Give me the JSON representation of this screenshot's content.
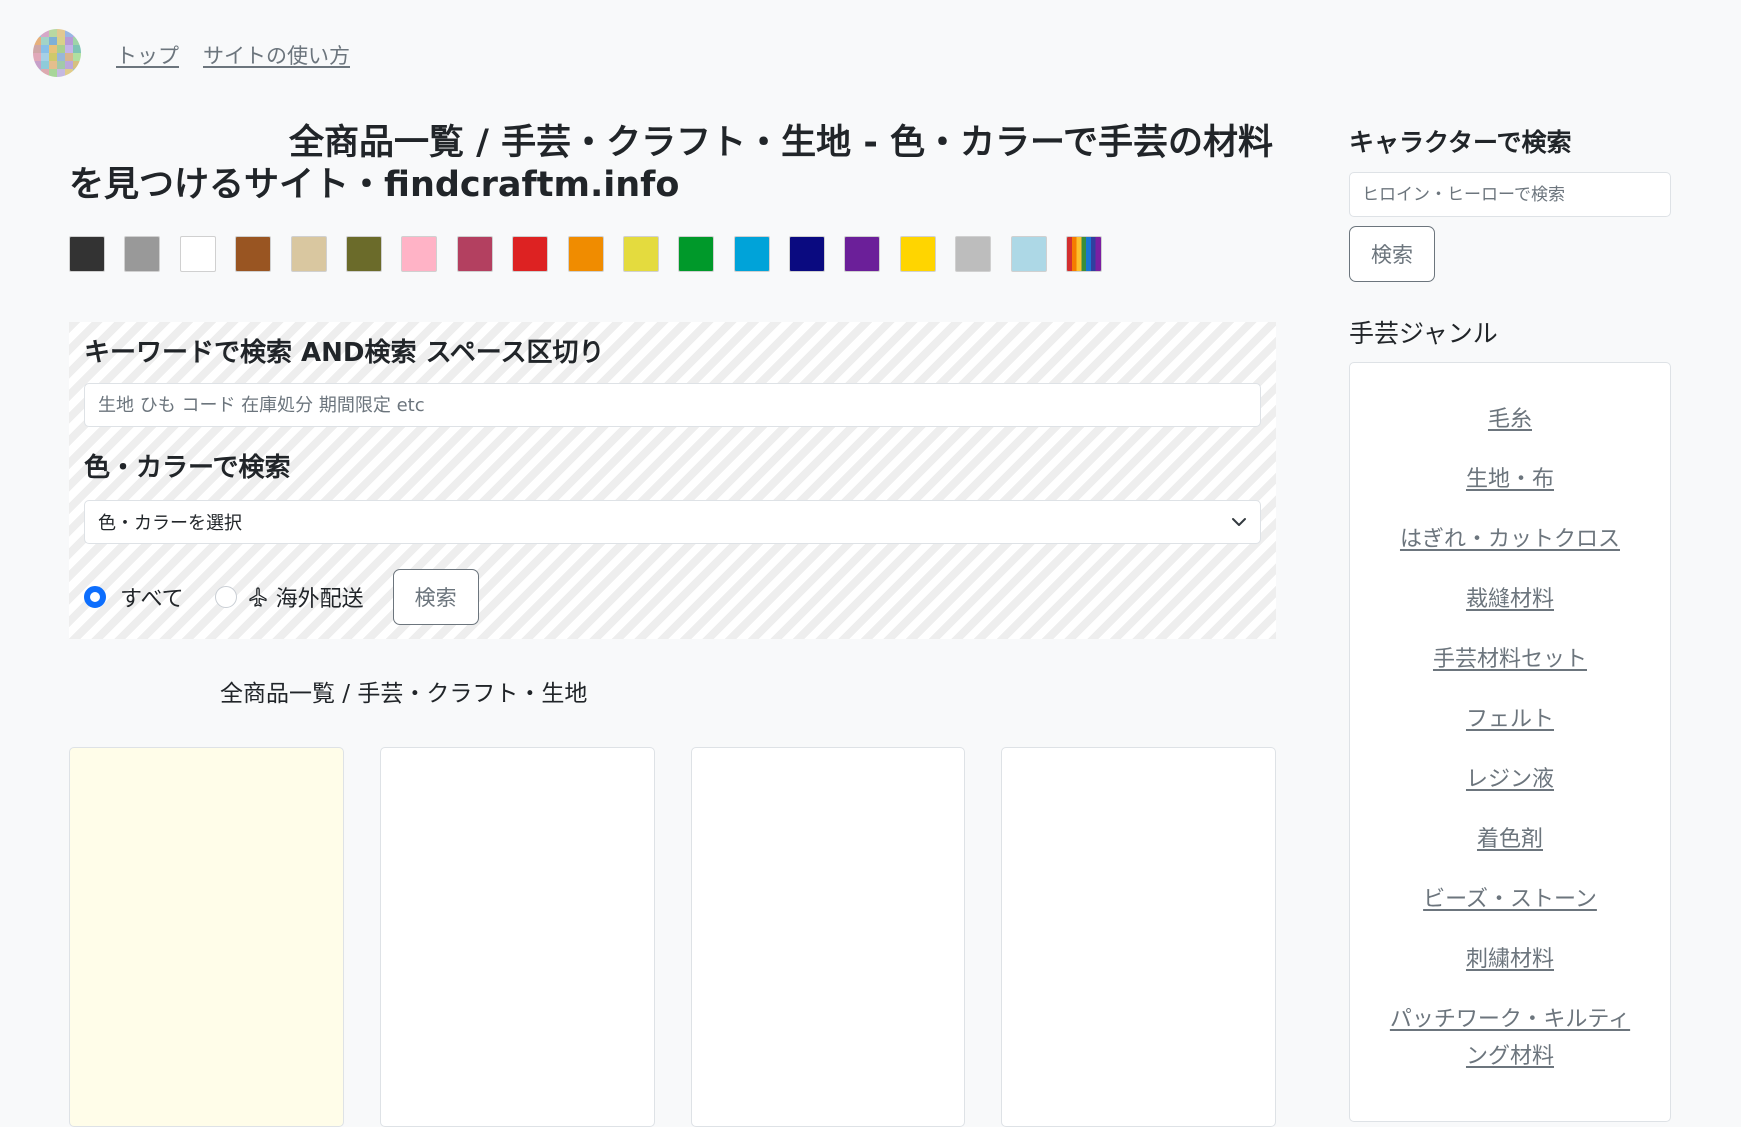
{
  "nav": {
    "logo_colors": [
      "#8fc7e0",
      "#d5a8c8",
      "#b8d8a2",
      "#e2c891",
      "#9ab6e3",
      "#c4a1d9",
      "#e6b07c",
      "#a3d4c6",
      "#7fb0d6",
      "#d9d08a",
      "#b79ad6",
      "#9fd4a8",
      "#cfa7a7",
      "#88c0e8",
      "#e8c27a",
      "#a9cf8f",
      "#c3b2e8",
      "#7ec4b5",
      "#e0a9b9",
      "#a6d0e6",
      "#cfc96b",
      "#98b7d8",
      "#d8b58f",
      "#b0dfa0",
      "#c6a0c9",
      "#8ecbd9",
      "#e4be8d",
      "#a2c9a8",
      "#bba7da",
      "#d6c07f",
      "#9bc2e0",
      "#dcaab0",
      "#a8d69a",
      "#c5b9e1",
      "#e0cc8a",
      "#96c6c8"
    ],
    "top_label": "トップ",
    "howto_label": "サイトの使い方"
  },
  "page": {
    "title": "全商品一覧 / 手芸・クラフト・生地 - 色・カラーで手芸の材料を見つけるサイト・findcraftm.info",
    "list_title": "全商品一覧 / 手芸・クラフト・生地"
  },
  "colors": [
    "#333333",
    "#999999",
    "#ffffff",
    "#995522",
    "#d9c7a0",
    "#6b6b2a",
    "#ffb3c6",
    "#b34060",
    "#dd2222",
    "#f08c00",
    "#e4db3e",
    "#00992a",
    "#00a3d9",
    "#0a0a80",
    "#6b1f99",
    "#ffd500",
    "#bdbdbd",
    "#add8e6",
    "rainbow"
  ],
  "search": {
    "keyword_heading": "キーワードで検索 AND検索 スペース区切り",
    "keyword_placeholder": "生地 ひも コード 在庫処分 期間限定 etc",
    "color_heading": "色・カラーで検索",
    "color_select_value": "色・カラーを選択",
    "radio_all_label": "すべて",
    "radio_overseas_label": "海外配送",
    "search_button": "検索"
  },
  "sidebar": {
    "character_heading": "キャラクターで検索",
    "character_placeholder": "ヒロイン・ヒーローで検索",
    "character_button": "検索",
    "genre_heading": "手芸ジャンル",
    "genres": [
      "毛糸",
      "生地・布",
      "はぎれ・カットクロス",
      "裁縫材料",
      "手芸材料セット",
      "フェルト",
      "レジン液",
      "着色剤",
      "ビーズ・ストーン",
      "刺繍材料",
      "パッチワーク・キルティング材料"
    ]
  }
}
